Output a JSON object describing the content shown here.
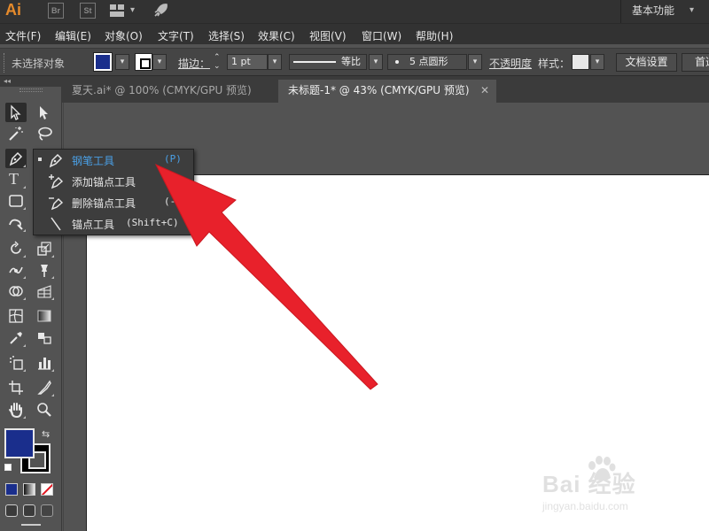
{
  "app": {
    "logo": "Ai",
    "badges": [
      "Br",
      "St"
    ],
    "workspace": "基本功能"
  },
  "menus": [
    "文件(F)",
    "编辑(E)",
    "对象(O)",
    "文字(T)",
    "选择(S)",
    "效果(C)",
    "视图(V)",
    "窗口(W)",
    "帮助(H)"
  ],
  "control": {
    "selection_status": "未选择对象",
    "fill_color": "#1A2E8C",
    "stroke_label": "描边：",
    "stroke_weight": "1 pt",
    "profile": "等比",
    "brush": "5 点圆形",
    "opacity_label": "不透明度",
    "style_label": "样式：",
    "doc_setup": "文档设置",
    "prefs": "首选"
  },
  "tabs": [
    {
      "title": "夏天.ai* @ 100% (CMYK/GPU 预览)",
      "active": false
    },
    {
      "title": "未标题-1* @ 43% (CMYK/GPU 预览)",
      "active": true
    }
  ],
  "toolbar": {
    "collapse": "◂◂",
    "type_tool": "T"
  },
  "flyout": {
    "items": [
      {
        "label": "钢笔工具",
        "shortcut": "(P)",
        "icon": "pen-icon",
        "selected": true
      },
      {
        "label": "添加锚点工具",
        "shortcut": "",
        "icon": "add-anchor-icon",
        "selected": false
      },
      {
        "label": "删除锚点工具",
        "shortcut": "(-",
        "icon": "delete-anchor-icon",
        "selected": false
      },
      {
        "label": "锚点工具",
        "shortcut": "(Shift+C)",
        "icon": "anchor-point-icon",
        "selected": false
      }
    ]
  },
  "watermark": {
    "main": "Bai 经验",
    "sub": "jingyan.baidu.com"
  },
  "colors": {
    "accent": "#4AA0E6",
    "fill": "#1A2E8C",
    "arrow": "#E8212B",
    "logo": "#E58A2B"
  }
}
